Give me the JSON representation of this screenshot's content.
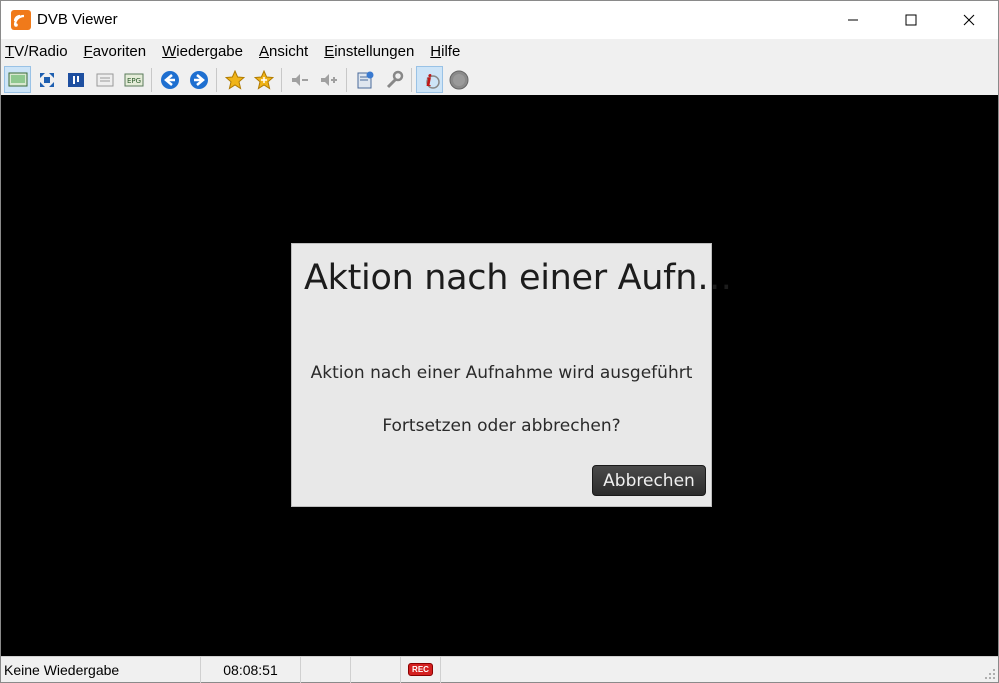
{
  "window": {
    "title": "DVB Viewer"
  },
  "menu": {
    "items": [
      {
        "label_ul": "T",
        "label_rest": "V/Radio"
      },
      {
        "label_ul": "F",
        "label_rest": "avoriten"
      },
      {
        "label_ul": "W",
        "label_rest": "iedergabe"
      },
      {
        "label_ul": "A",
        "label_rest": "nsicht"
      },
      {
        "label_ul": "E",
        "label_rest": "instellungen"
      },
      {
        "label_ul": "H",
        "label_rest": "ilfe"
      }
    ]
  },
  "toolbar": {
    "icons": [
      "screen-icon",
      "fullscreen-icon",
      "teletext-icon",
      "info-panel-icon",
      "epg-icon",
      "back-icon",
      "forward-icon",
      "favorite-icon",
      "favorite-add-icon",
      "volume-down-icon",
      "volume-up-icon",
      "recorder-icon",
      "settings-icon",
      "osd-info-icon",
      "record-icon"
    ],
    "epg_label": "EPG"
  },
  "dialog": {
    "title": "Aktion nach einer Aufn…",
    "message": "Aktion nach einer Aufnahme wird ausgeführt",
    "question": "Fortsetzen oder abbrechen?",
    "cancel_label": "Abbrechen"
  },
  "statusbar": {
    "status": "Keine Wiedergabe",
    "time": "08:08:51",
    "rec_label": "REC"
  },
  "colors": {
    "video_bg": "#000000",
    "dialog_bg": "#e8e8e8",
    "rec_red": "#d42020",
    "toolbar_blue": "#1e6fd0",
    "star_gold": "#f0b418"
  }
}
